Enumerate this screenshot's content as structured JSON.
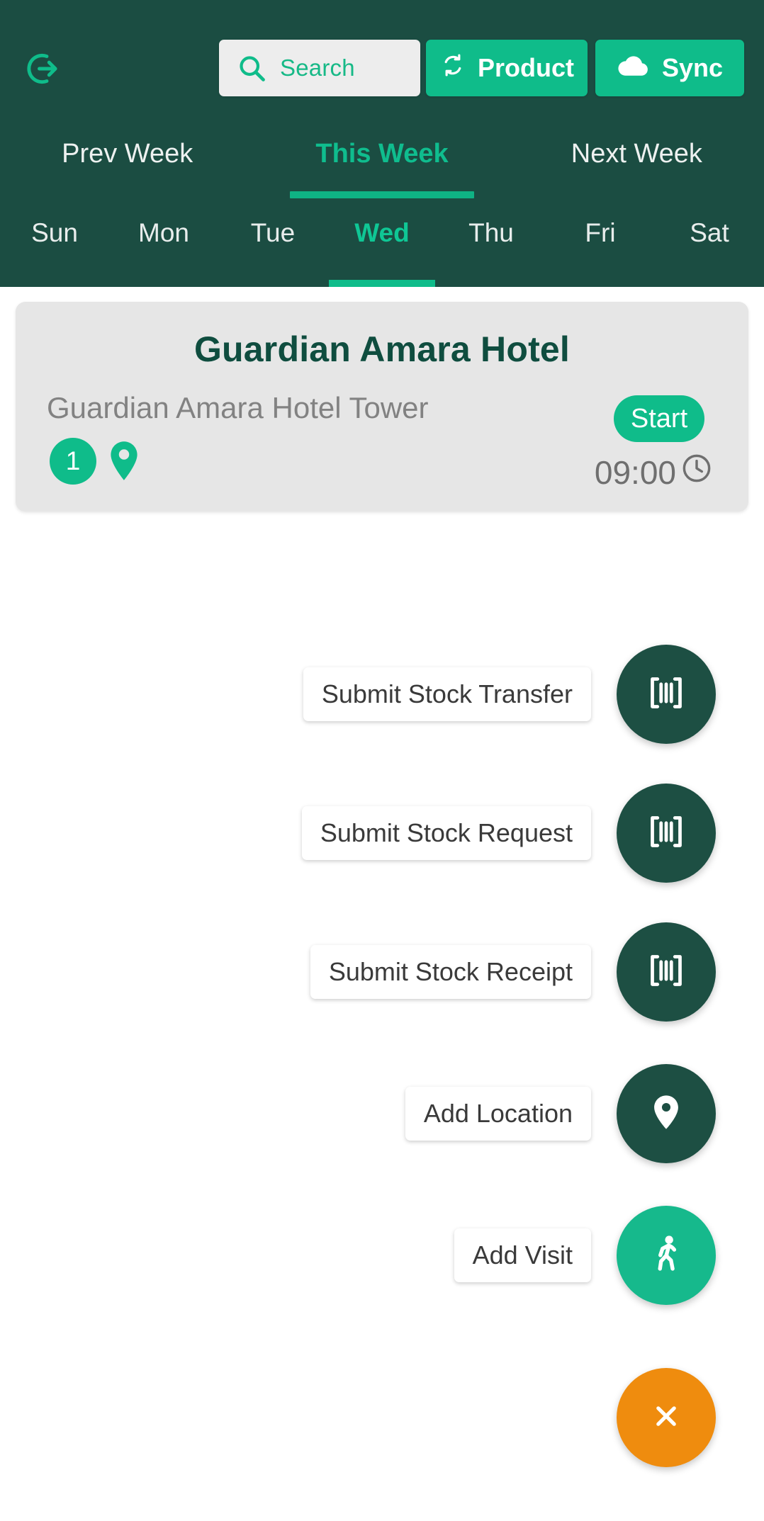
{
  "theme": {
    "header_bg": "#1b4d42",
    "accent": "#0fbc8a",
    "accent_bright": "#0fc795",
    "card_bg": "#e6e6e6",
    "card_title_color": "#0f4d3f",
    "fab_dark": "#1d4f43",
    "fab_teal": "#16b98c",
    "fab_orange": "#ef8c0e",
    "page_bg": "#ffffff"
  },
  "header": {
    "logout_icon": "logout-icon",
    "search": {
      "icon": "search-icon",
      "placeholder": "Search",
      "value": ""
    },
    "actions": [
      {
        "label": "Product",
        "icon": "refresh-icon"
      },
      {
        "label": "Sync",
        "icon": "cloud-icon"
      }
    ]
  },
  "week_tabs": [
    {
      "label": "Prev Week",
      "active": false
    },
    {
      "label": "This Week",
      "active": true
    },
    {
      "label": "Next Week",
      "active": false
    }
  ],
  "day_tabs": [
    {
      "label": "Sun",
      "active": false
    },
    {
      "label": "Mon",
      "active": false
    },
    {
      "label": "Tue",
      "active": false
    },
    {
      "label": "Wed",
      "active": true
    },
    {
      "label": "Thu",
      "active": false
    },
    {
      "label": "Fri",
      "active": false
    },
    {
      "label": "Sat",
      "active": false
    }
  ],
  "visit_card": {
    "title": "Guardian Amara Hotel",
    "subtitle": "Guardian Amara Hotel Tower",
    "count_badge": "1",
    "pin_icon": "location-pin-icon",
    "start_label": "Start",
    "time": "09:00",
    "clock_icon": "clock-icon"
  },
  "speed_dial": {
    "items": [
      {
        "label": "Submit Stock Transfer",
        "icon": "barcode-icon",
        "color": "#1d4f43"
      },
      {
        "label": "Submit Stock Request",
        "icon": "barcode-icon",
        "color": "#1d4f43"
      },
      {
        "label": "Submit Stock Receipt",
        "icon": "barcode-icon",
        "color": "#1d4f43"
      },
      {
        "label": "Add Location",
        "icon": "location-pin-icon",
        "color": "#1d4f43"
      },
      {
        "label": "Add Visit",
        "icon": "walking-icon",
        "color": "#16b98c"
      }
    ],
    "main": {
      "icon": "close-icon",
      "color": "#ef8c0e"
    }
  }
}
